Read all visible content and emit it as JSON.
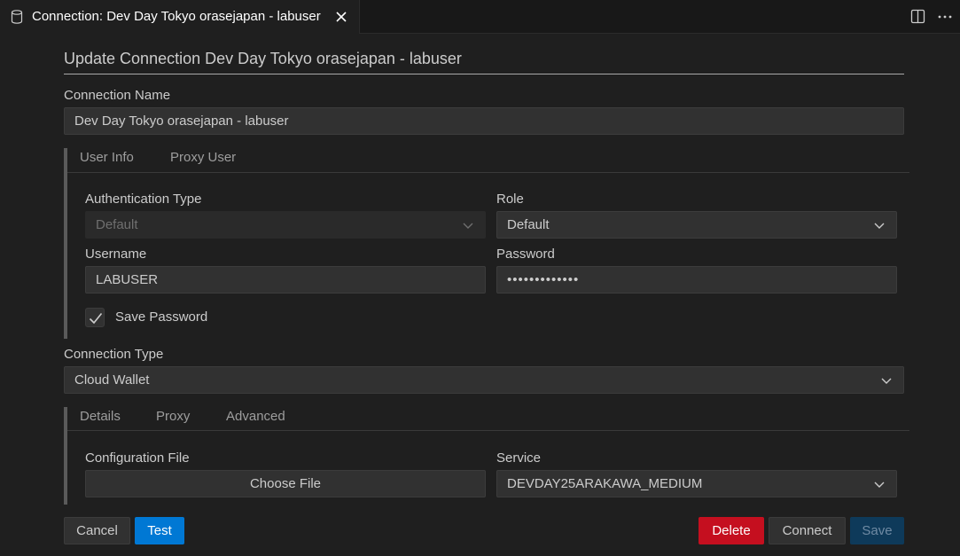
{
  "tab": {
    "title": "Connection: Dev Day Tokyo orasejapan - labuser",
    "icon": "database-icon"
  },
  "header": {
    "title": "Update Connection Dev Day Tokyo orasejapan - labuser"
  },
  "connection_name": {
    "label": "Connection Name",
    "value": "Dev Day Tokyo orasejapan - labuser"
  },
  "user_section": {
    "tabs": [
      "User Info",
      "Proxy User"
    ],
    "auth_type": {
      "label": "Authentication Type",
      "value": "Default"
    },
    "role": {
      "label": "Role",
      "value": "Default"
    },
    "username": {
      "label": "Username",
      "value": "LABUSER"
    },
    "password": {
      "label": "Password",
      "value": "•••••••••••••"
    },
    "save_password": {
      "label": "Save Password",
      "checked": true
    }
  },
  "connection_type": {
    "label": "Connection Type",
    "value": "Cloud Wallet"
  },
  "details_section": {
    "tabs": [
      "Details",
      "Proxy",
      "Advanced"
    ],
    "config_file": {
      "label": "Configuration File",
      "button": "Choose File"
    },
    "service": {
      "label": "Service",
      "value": "DEVDAY25ARAKAWA_MEDIUM"
    }
  },
  "buttons": {
    "cancel": "Cancel",
    "test": "Test",
    "delete": "Delete",
    "connect": "Connect",
    "save": "Save"
  },
  "colors": {
    "primary": "#0078d4",
    "danger": "#c50f1f",
    "background": "#1f1f1f"
  }
}
